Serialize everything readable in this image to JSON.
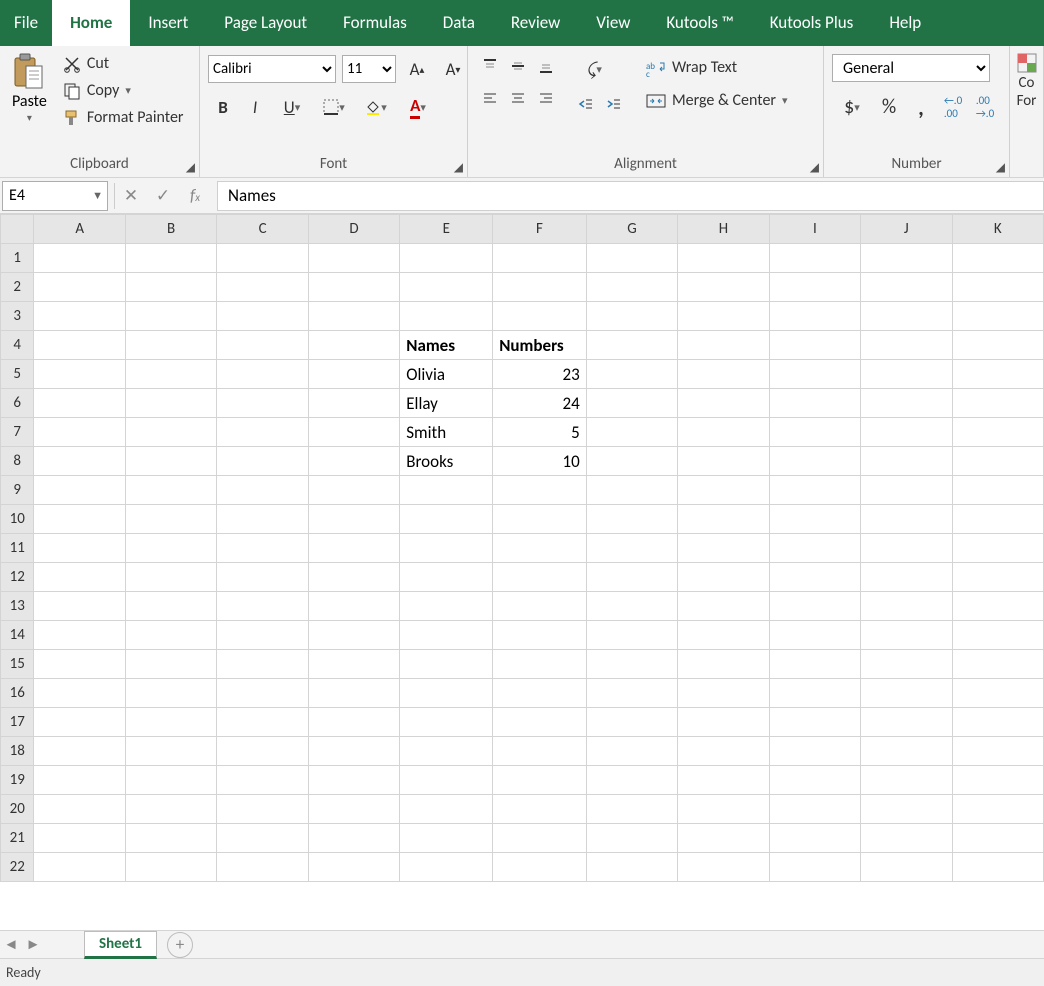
{
  "tabs": {
    "file": "File",
    "home": "Home",
    "insert": "Insert",
    "page_layout": "Page Layout",
    "formulas": "Formulas",
    "data": "Data",
    "review": "Review",
    "view": "View",
    "kutools": "Kutools ™",
    "kutools_plus": "Kutools Plus",
    "help": "Help"
  },
  "ribbon": {
    "clipboard": {
      "paste": "Paste",
      "cut": "Cut",
      "copy": "Copy",
      "format_painter": "Format Painter",
      "label": "Clipboard"
    },
    "font": {
      "name": "Calibri",
      "size": "11",
      "label": "Font"
    },
    "alignment": {
      "wrap_text": "Wrap Text",
      "merge_center": "Merge & Center",
      "label": "Alignment"
    },
    "number": {
      "format": "General",
      "label": "Number"
    },
    "cond": {
      "line1": "Co",
      "line2": "For"
    }
  },
  "formula_bar": {
    "cell_ref": "E4",
    "value": "Names"
  },
  "grid": {
    "columns": [
      "A",
      "B",
      "C",
      "D",
      "E",
      "F",
      "G",
      "H",
      "I",
      "J",
      "K"
    ],
    "row_count": 22,
    "cells": {
      "E4": {
        "v": "Names",
        "t": "text",
        "bold": true
      },
      "F4": {
        "v": "Numbers",
        "t": "text",
        "bold": true
      },
      "E5": {
        "v": "Olivia",
        "t": "text"
      },
      "F5": {
        "v": "23",
        "t": "num"
      },
      "E6": {
        "v": "Ellay",
        "t": "text"
      },
      "F6": {
        "v": "24",
        "t": "num"
      },
      "E7": {
        "v": "Smith",
        "t": "text"
      },
      "F7": {
        "v": "5",
        "t": "num"
      },
      "E8": {
        "v": "Brooks",
        "t": "text"
      },
      "F8": {
        "v": "10",
        "t": "num"
      }
    }
  },
  "sheet_bar": {
    "sheet1": "Sheet1"
  },
  "status": {
    "ready": "Ready"
  }
}
